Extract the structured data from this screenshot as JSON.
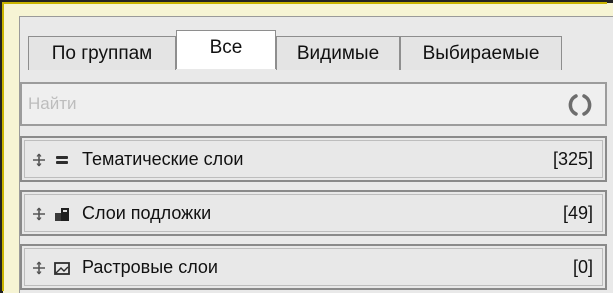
{
  "tabs": [
    {
      "label": "По группам",
      "active": false
    },
    {
      "label": "Все",
      "active": true
    },
    {
      "label": "Видимые",
      "active": false
    },
    {
      "label": "Выбираемые",
      "active": false
    }
  ],
  "search": {
    "placeholder": "Найти"
  },
  "layer_groups": [
    {
      "label": "Тематические слои",
      "count": "[325]",
      "icon": "thematic-layers-icon"
    },
    {
      "label": "Слои подложки",
      "count": "[49]",
      "icon": "basemap-layers-icon"
    },
    {
      "label": "Растровые слои",
      "count": "[0]",
      "icon": "raster-layers-icon"
    }
  ],
  "colors": {
    "frame_background": "#f6f4d4",
    "panel_background": "#e9e9e9",
    "active_tab": "#ffffff"
  }
}
